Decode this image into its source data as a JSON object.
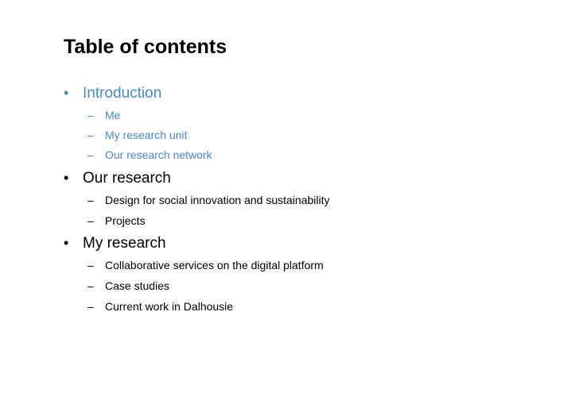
{
  "slide": {
    "title": "Table of contents",
    "accent_color": "#4a86d4",
    "sections": [
      {
        "label": "Introduction",
        "highlighted": true,
        "items": [
          "Me",
          "My research unit",
          "Our research network"
        ]
      },
      {
        "label": "Our research",
        "highlighted": false,
        "items": [
          "Design for social innovation and sustainability",
          "Projects"
        ]
      },
      {
        "label": "My research",
        "highlighted": false,
        "items": [
          "Collaborative services on the digital platform",
          "Case studies",
          "Current work in Dalhousie"
        ]
      }
    ],
    "bullet_glyph": "•",
    "dash_glyph": "–"
  }
}
